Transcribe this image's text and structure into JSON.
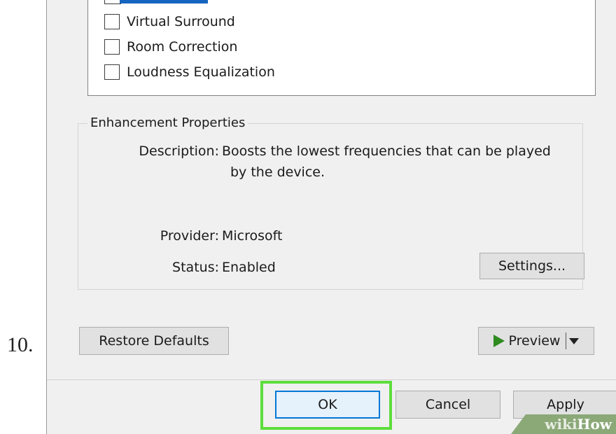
{
  "step_number": "10.",
  "enhancements": {
    "items": [
      {
        "label": "Virtual Surround",
        "checked": false
      },
      {
        "label": "Room Correction",
        "checked": false
      },
      {
        "label": "Loudness Equalization",
        "checked": false
      }
    ]
  },
  "enhancement_properties": {
    "title": "Enhancement Properties",
    "description_label": "Description:",
    "description_line1": "Boosts the lowest frequencies that can be played",
    "description_line2": "by the device.",
    "provider_label": "Provider:",
    "provider_value": "Microsoft",
    "status_label": "Status:",
    "status_value": "Enabled",
    "settings_button": "Settings..."
  },
  "actions": {
    "restore_defaults": "Restore Defaults",
    "preview": "Preview"
  },
  "footer": {
    "ok": "OK",
    "cancel": "Cancel",
    "apply": "Apply"
  },
  "watermark": {
    "part1": "wiki",
    "part2": "How"
  },
  "colors": {
    "highlight": "#5dde3c",
    "play": "#2e8b1f",
    "focus": "#0078d7"
  }
}
